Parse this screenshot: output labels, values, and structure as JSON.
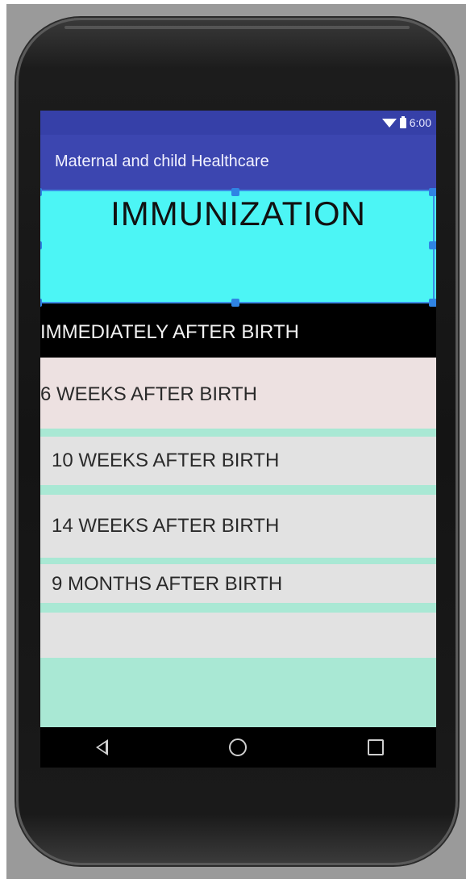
{
  "status_bar": {
    "time": "6:00",
    "icons": [
      "wifi-icon",
      "battery-icon"
    ]
  },
  "app_bar": {
    "title": "Maternal and child Healthcare"
  },
  "header": {
    "title": "IMMUNIZATION"
  },
  "schedule": {
    "items": [
      {
        "label": "IMMEDIATELY AFTER BIRTH"
      },
      {
        "label": "6 WEEKS AFTER BIRTH"
      },
      {
        "label": "10 WEEKS AFTER BIRTH"
      },
      {
        "label": "14 WEEKS AFTER BIRTH"
      },
      {
        "label": "9 MONTHS AFTER BIRTH"
      },
      {
        "label": ""
      }
    ]
  },
  "navigation": {
    "buttons": [
      "back-icon",
      "home-icon",
      "recents-icon"
    ]
  },
  "colors": {
    "app_bar": "#3c46b0",
    "status_bar": "#3640a8",
    "header_bg": "#4cf5f5",
    "selection": "#3a8ee6",
    "list_bg": "#a9e8d4",
    "list_item_bg": "#e2e2e2"
  }
}
